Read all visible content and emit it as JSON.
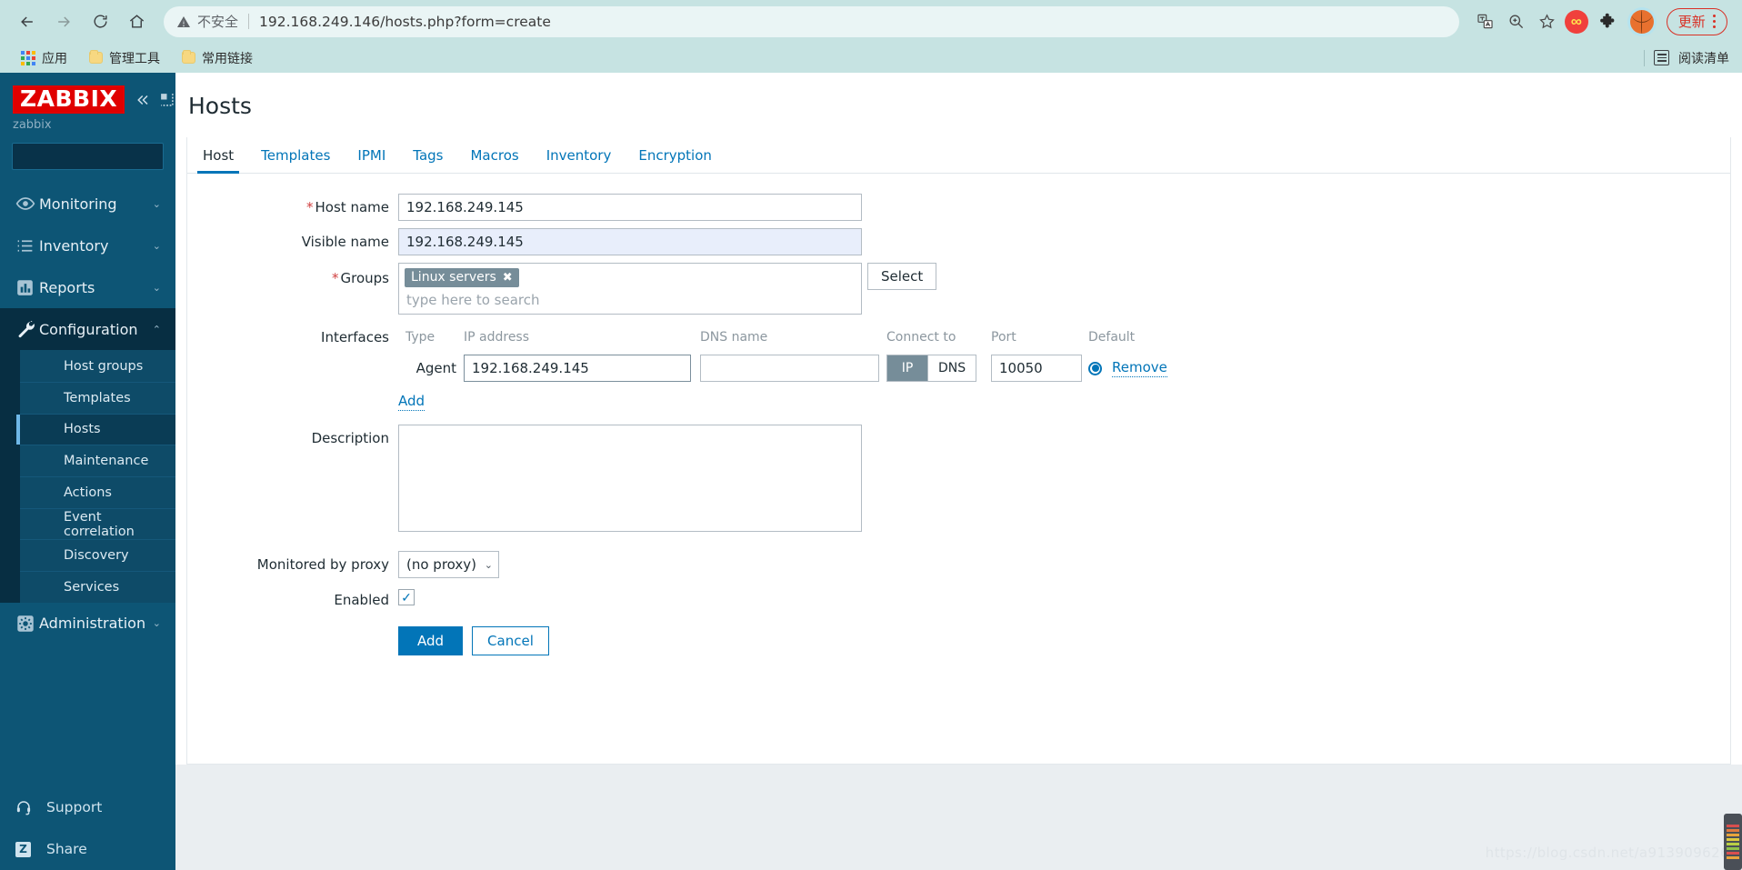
{
  "browser": {
    "nav": {
      "back_icon": "back-arrow-icon",
      "forward_icon": "forward-arrow-icon",
      "reload_icon": "reload-icon",
      "home_icon": "home-icon"
    },
    "omnibox": {
      "security_warning": "不安全",
      "url": "192.168.249.146/hosts.php?form=create",
      "translate_icon": "translate-icon",
      "zoom_icon": "zoom-in-icon",
      "bookmark_icon": "star-icon"
    },
    "extensions": {
      "infinity_label": "∞",
      "puzzle_icon": "puzzle-piece-icon",
      "basketball_icon": "basketball-icon",
      "update_label": "更新",
      "menu_icon": "kebab-menu-icon"
    },
    "bookmarks": {
      "apps_label": "应用",
      "items": [
        {
          "label": "管理工具"
        },
        {
          "label": "常用链接"
        }
      ],
      "reading_list_label": "阅读清单"
    }
  },
  "sidebar": {
    "logo": "ZABBIX",
    "server_name": "zabbix",
    "collapse_icon": "chevron-double-left-icon",
    "hide_icon": "collapse-pane-icon",
    "search_placeholder": "",
    "search_value": "",
    "search_icon": "search-icon",
    "sections": [
      {
        "label": "Monitoring",
        "icon": "eye-icon",
        "expanded": false,
        "chevron": "⌄"
      },
      {
        "label": "Inventory",
        "icon": "list-icon",
        "expanded": false,
        "chevron": "⌄"
      },
      {
        "label": "Reports",
        "icon": "bar-chart-icon",
        "expanded": false,
        "chevron": "⌄"
      },
      {
        "label": "Configuration",
        "icon": "wrench-icon",
        "expanded": true,
        "chevron": "⌃"
      }
    ],
    "config_items": [
      {
        "label": "Host groups",
        "selected": false
      },
      {
        "label": "Templates",
        "selected": false
      },
      {
        "label": "Hosts",
        "selected": true
      },
      {
        "label": "Maintenance",
        "selected": false
      },
      {
        "label": "Actions",
        "selected": false
      },
      {
        "label": "Event correlation",
        "selected": false
      },
      {
        "label": "Discovery",
        "selected": false
      },
      {
        "label": "Services",
        "selected": false
      }
    ],
    "administration": {
      "label": "Administration",
      "icon": "gear-icon",
      "chevron": "⌄"
    },
    "bottom": [
      {
        "label": "Support",
        "icon": "headset-icon"
      },
      {
        "label": "Share",
        "icon": "zabbix-share-icon"
      }
    ]
  },
  "page": {
    "title": "Hosts"
  },
  "tabs": [
    {
      "label": "Host",
      "active": true
    },
    {
      "label": "Templates",
      "active": false
    },
    {
      "label": "IPMI",
      "active": false
    },
    {
      "label": "Tags",
      "active": false
    },
    {
      "label": "Macros",
      "active": false
    },
    {
      "label": "Inventory",
      "active": false
    },
    {
      "label": "Encryption",
      "active": false
    }
  ],
  "form": {
    "host_name": {
      "label": "Host name",
      "required": true,
      "value": "192.168.249.145"
    },
    "visible_name": {
      "label": "Visible name",
      "required": false,
      "value": "192.168.249.145"
    },
    "groups": {
      "label": "Groups",
      "required": true,
      "chips": [
        {
          "label": "Linux servers",
          "remove_icon": "✖"
        }
      ],
      "placeholder": "type here to search",
      "select_button": "Select"
    },
    "interfaces": {
      "label": "Interfaces",
      "columns": {
        "type": "Type",
        "ip_address": "IP address",
        "dns_name": "DNS name",
        "connect_to": "Connect to",
        "port": "Port",
        "default": "Default"
      },
      "rows": [
        {
          "type": "Agent",
          "ip_address": "192.168.249.145",
          "dns_name": "",
          "connect_options": [
            "IP",
            "DNS"
          ],
          "connect_selected": "IP",
          "port": "10050",
          "default_selected": true,
          "remove_label": "Remove"
        }
      ],
      "add_label": "Add"
    },
    "description": {
      "label": "Description",
      "value": ""
    },
    "monitored_by_proxy": {
      "label": "Monitored by proxy",
      "value": "(no proxy)",
      "options": [
        "(no proxy)"
      ],
      "chevron": "⌄"
    },
    "enabled": {
      "label": "Enabled",
      "checked": true,
      "check_glyph": "✓"
    },
    "actions": {
      "submit": "Add",
      "cancel": "Cancel"
    }
  },
  "watermark": {
    "text": "https://blog.csdn.net/a913909626"
  },
  "colors": {
    "brand_red": "#e00000",
    "sidebar_bg": "#0d5575",
    "accent_blue": "#0275b8",
    "chip_grey": "#768d99",
    "chrome_bg": "#c6e3e2"
  }
}
